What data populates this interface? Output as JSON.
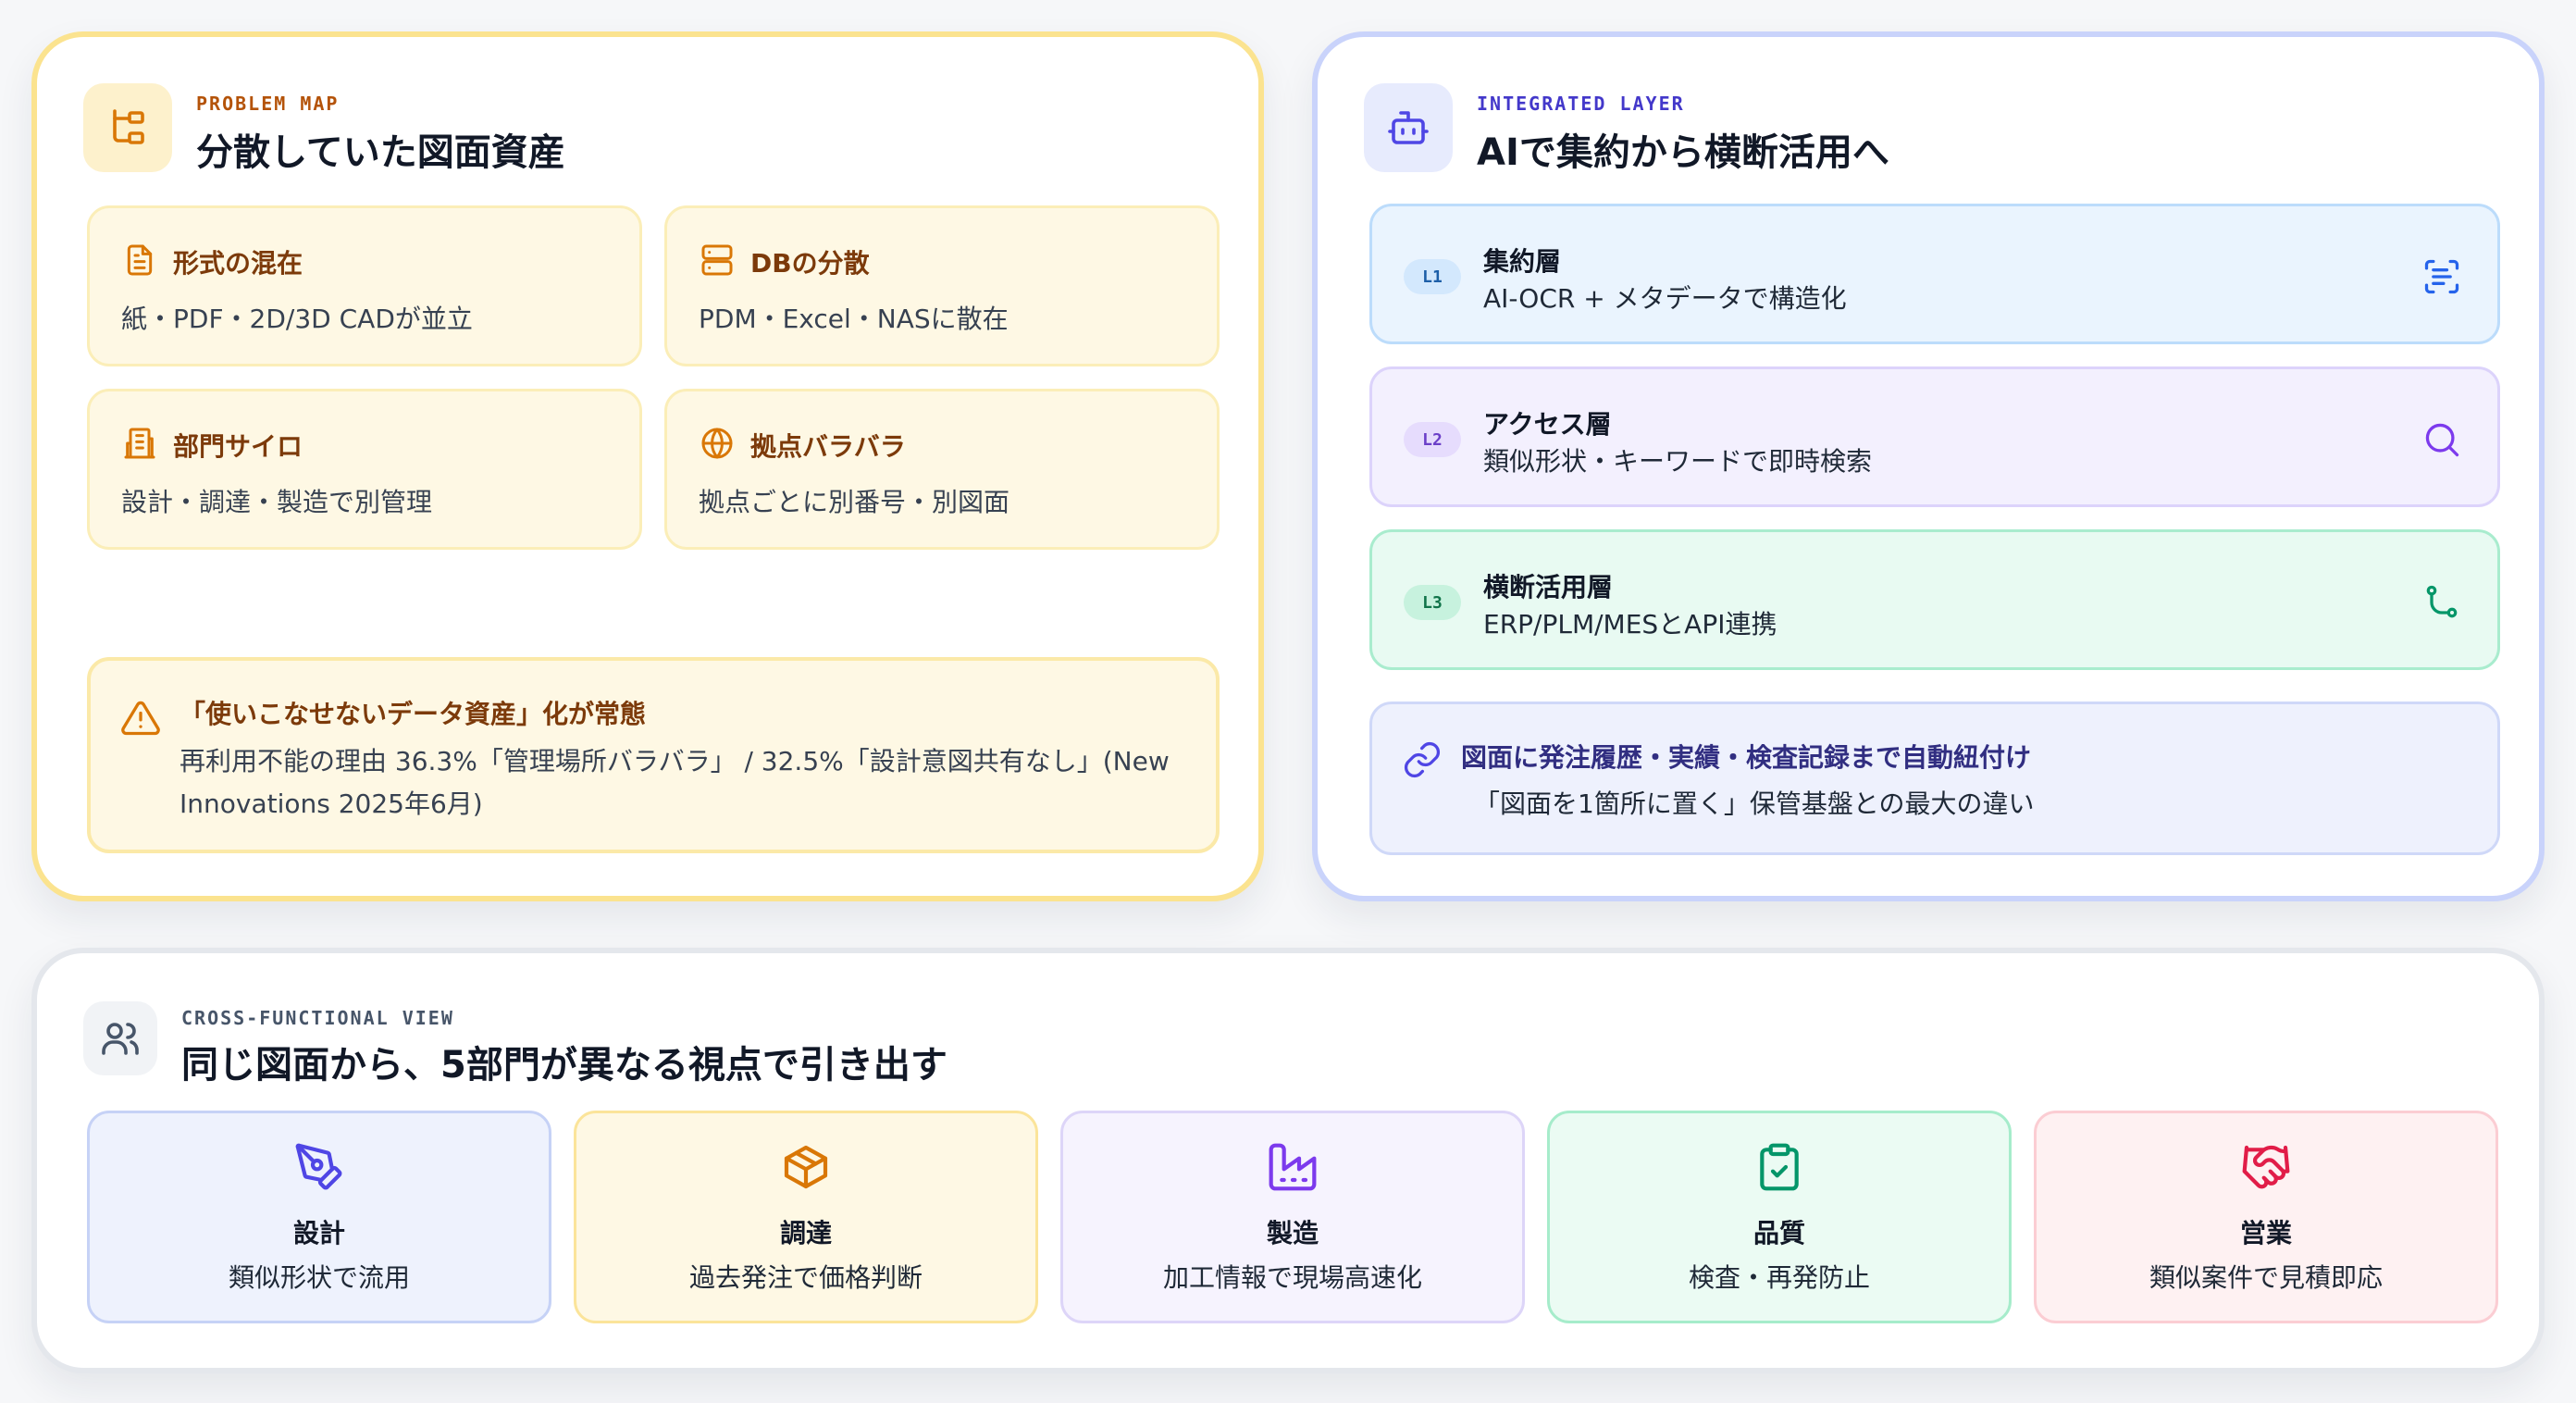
{
  "problem": {
    "eyebrow": "PROBLEM MAP",
    "title": "分散していた図面資産",
    "icon": "hierarchy-icon",
    "cards": [
      {
        "icon": "document-icon",
        "title": "形式の混在",
        "desc": "紙・PDF・2D/3D CADが並立"
      },
      {
        "icon": "database-icon",
        "title": "DBの分散",
        "desc": "PDM・Excel・NASに散在"
      },
      {
        "icon": "building-icon",
        "title": "部門サイロ",
        "desc": "設計・調達・製造で別管理"
      },
      {
        "icon": "globe-icon",
        "title": "拠点バラバラ",
        "desc": "拠点ごとに別番号・別図面"
      }
    ],
    "warning": {
      "icon": "warning-icon",
      "title": "「使いこなせないデータ資産」化が常態",
      "desc": "再利用不能の理由 36.3%「管理場所バラバラ」 / 32.5%「設計意図共有なし」(New Innovations 2025年6月)"
    }
  },
  "layer": {
    "eyebrow": "INTEGRATED LAYER",
    "title": "AIで集約から横断活用へ",
    "icon": "robot-icon",
    "layers": [
      {
        "badge": "L1",
        "title": "集約層",
        "desc": "AI-OCR + メタデータで構造化",
        "icon": "scan-text-icon"
      },
      {
        "badge": "L2",
        "title": "アクセス層",
        "desc": "類似形状・キーワードで即時検索",
        "icon": "search-icon"
      },
      {
        "badge": "L3",
        "title": "横断活用層",
        "desc": "ERP/PLM/MESとAPI連携",
        "icon": "branch-icon"
      }
    ],
    "link": {
      "icon": "link-icon",
      "title": "図面に発注履歴・実績・検査記録まで自動紐付け",
      "desc": "「図面を1箇所に置く」保管基盤との最大の違い"
    }
  },
  "cross": {
    "eyebrow": "CROSS-FUNCTIONAL VIEW",
    "title": "同じ図面から、5部門が異なる視点で引き出す",
    "icon": "users-icon",
    "departments": [
      {
        "icon": "pen-tool-icon",
        "title": "設計",
        "desc": "類似形状で流用",
        "color": "#4f46e5"
      },
      {
        "icon": "package-icon",
        "title": "調達",
        "desc": "過去発注で価格判断",
        "color": "#d97706"
      },
      {
        "icon": "factory-icon",
        "title": "製造",
        "desc": "加工情報で現場高速化",
        "color": "#7c3aed"
      },
      {
        "icon": "clipboard-check-icon",
        "title": "品質",
        "desc": "検査・再発防止",
        "color": "#059669"
      },
      {
        "icon": "handshake-icon",
        "title": "営業",
        "desc": "類似案件で見積即応",
        "color": "#e11d48"
      }
    ]
  },
  "colors": {
    "problem_accent": "#d97706",
    "layer_accent": "#4f46e5",
    "problem_border": "#fbe38f",
    "layer_border": "#c9d3fb"
  }
}
